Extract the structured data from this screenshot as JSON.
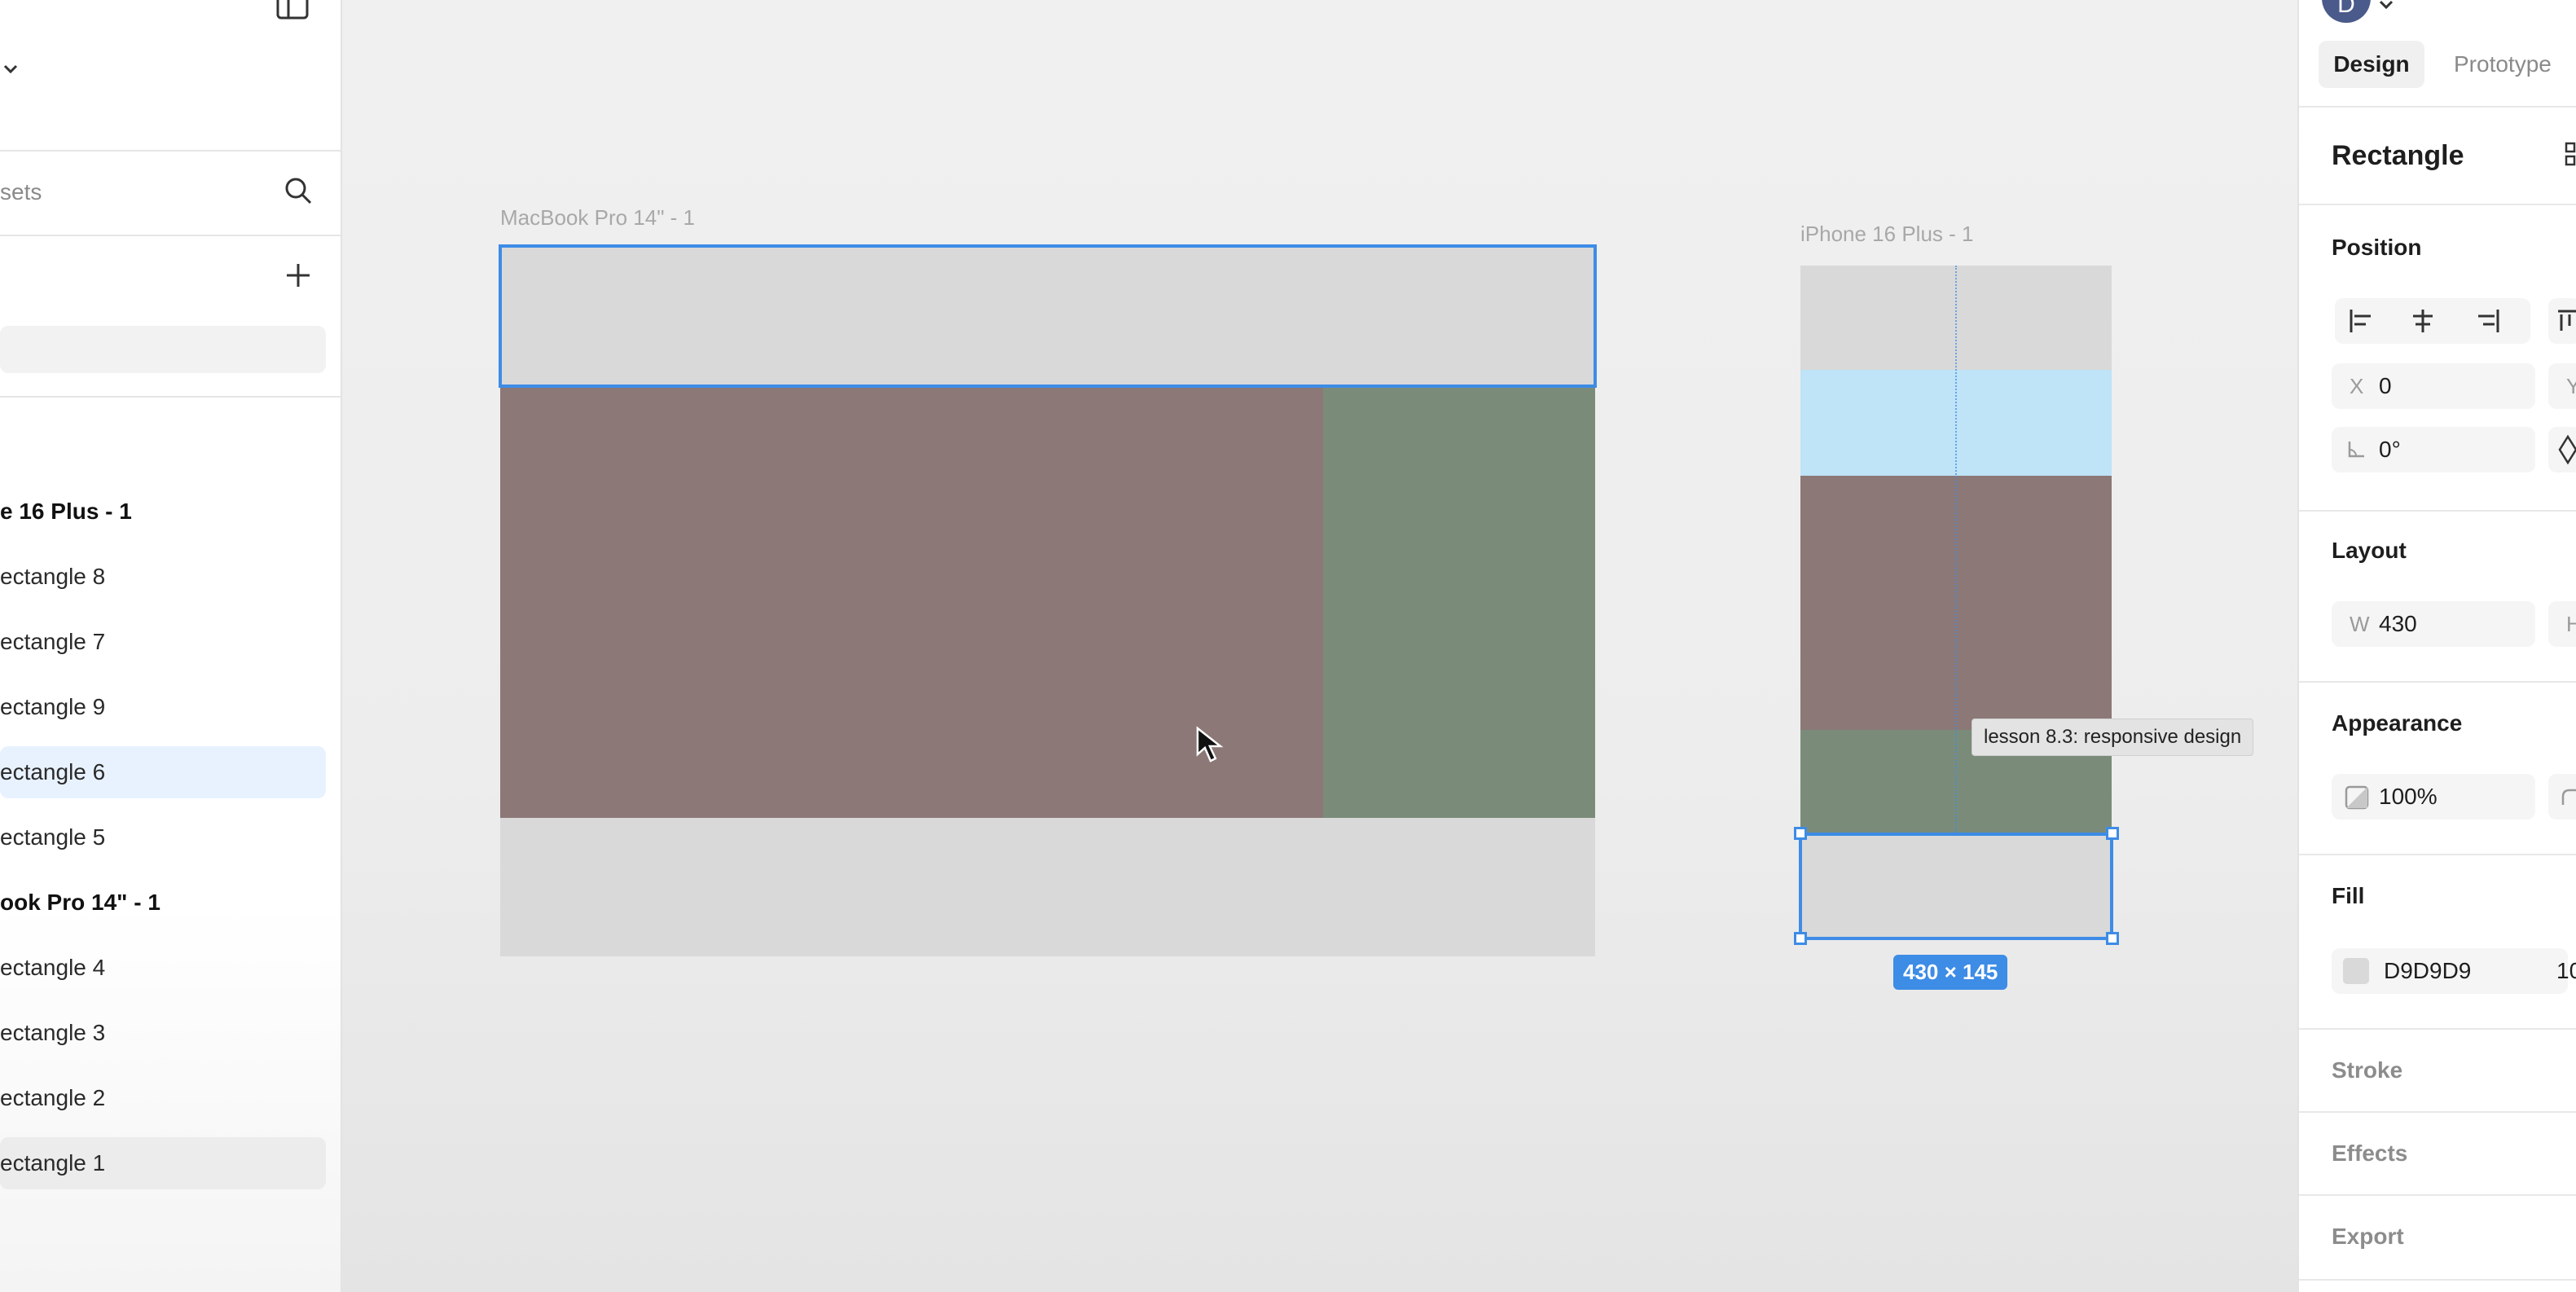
{
  "sidebar": {
    "search_placeholder": "sets",
    "layers": [
      {
        "label": "e 16 Plus - 1",
        "kind": "frame",
        "state": "normal"
      },
      {
        "label": "ectangle 8",
        "kind": "rect",
        "state": "normal"
      },
      {
        "label": "ectangle 7",
        "kind": "rect",
        "state": "normal"
      },
      {
        "label": "ectangle 9",
        "kind": "rect",
        "state": "normal"
      },
      {
        "label": "ectangle 6",
        "kind": "rect",
        "state": "selected"
      },
      {
        "label": "ectangle 5",
        "kind": "rect",
        "state": "normal"
      },
      {
        "label": "ook Pro 14\" - 1",
        "kind": "frame",
        "state": "normal"
      },
      {
        "label": "ectangle 4",
        "kind": "rect",
        "state": "normal"
      },
      {
        "label": "ectangle 3",
        "kind": "rect",
        "state": "normal"
      },
      {
        "label": "ectangle 2",
        "kind": "rect",
        "state": "normal"
      },
      {
        "label": "ectangle 1",
        "kind": "rect",
        "state": "hover"
      }
    ],
    "icons": [
      "panel-toggle-icon",
      "chevron-down-icon",
      "search-icon",
      "plus-icon"
    ]
  },
  "canvas": {
    "macbook_frame_label": "MacBook Pro 14\" - 1",
    "iphone_frame_label": "iPhone 16 Plus - 1",
    "selection_size": "430 × 145",
    "tooltip": "lesson 8.3:  responsive design",
    "colors": {
      "gray": "#d9d9d9",
      "brown": "#8b7877",
      "green": "#7a8c79",
      "light_blue": "#bfe3f7",
      "selection": "#3d8ce6"
    }
  },
  "rpanel": {
    "tabs": {
      "design": "Design",
      "prototype": "Prototype"
    },
    "element_title": "Rectangle",
    "position": {
      "heading": "Position",
      "x_label": "X",
      "x_value": "0",
      "y_label": "Y",
      "rotation": "0°"
    },
    "layout": {
      "heading": "Layout",
      "w_label": "W",
      "w_value": "430",
      "h_label": "H"
    },
    "appearance": {
      "heading": "Appearance",
      "opacity": "100%"
    },
    "fill": {
      "heading": "Fill",
      "hex": "D9D9D9",
      "opacity_partial": "10",
      "swatch": "#d9d9d9"
    },
    "stroke": "Stroke",
    "effects": "Effects",
    "export": "Export",
    "avatar_letter": "D"
  }
}
